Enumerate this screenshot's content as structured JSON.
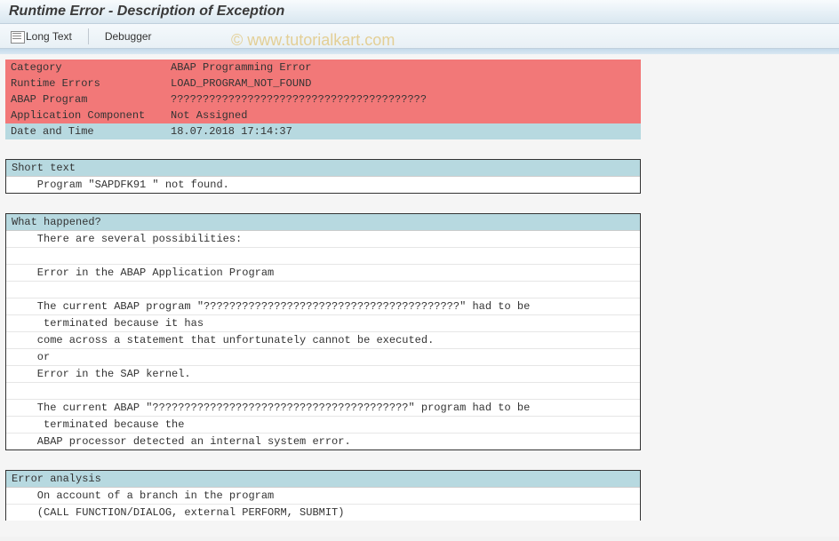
{
  "header": {
    "title": "Runtime Error - Description of Exception"
  },
  "toolbar": {
    "longtext_label": "Long Text",
    "debugger_label": "Debugger"
  },
  "watermark": "© www.tutorialkart.com",
  "info": {
    "category_label": "Category",
    "category_value": "ABAP Programming Error",
    "runtime_errors_label": "Runtime Errors",
    "runtime_errors_value": "LOAD_PROGRAM_NOT_FOUND",
    "abap_program_label": "ABAP Program",
    "abap_program_value": "????????????????????????????????????????",
    "app_component_label": "Application Component",
    "app_component_value": "Not Assigned",
    "datetime_label": "Date and Time",
    "datetime_value": "18.07.2018 17:14:37"
  },
  "short_text": {
    "header": "Short text",
    "lines": [
      "    Program \"SAPDFK91 \" not found."
    ]
  },
  "what_happened": {
    "header": "What happened?",
    "lines": [
      "    There are several possibilities:",
      "",
      "    Error in the ABAP Application Program",
      "",
      "    The current ABAP program \"????????????????????????????????????????\" had to be",
      "     terminated because it has",
      "    come across a statement that unfortunately cannot be executed.",
      "    or",
      "    Error in the SAP kernel.",
      "",
      "    The current ABAP \"????????????????????????????????????????\" program had to be",
      "     terminated because the",
      "    ABAP processor detected an internal system error."
    ]
  },
  "error_analysis": {
    "header": "Error analysis",
    "lines": [
      "    On account of a branch in the program",
      "    (CALL FUNCTION/DIALOG, external PERFORM, SUBMIT)"
    ]
  }
}
